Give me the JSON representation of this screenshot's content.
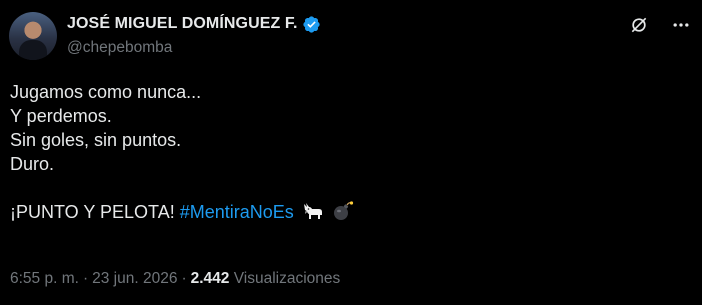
{
  "author": {
    "display_name": "JOSÉ MIGUEL DOMÍNGUEZ F.",
    "handle": "@chepebomba",
    "verified_icon": "verified-badge-icon",
    "avatar": "avatar"
  },
  "actions": {
    "grok_icon": "grok-icon",
    "more_icon": "more-icon"
  },
  "post": {
    "lines": [
      "Jugamos como nunca...",
      "Y perdemos.",
      "Sin goles, sin puntos.",
      "Duro."
    ],
    "last_line_text": "¡PUNTO Y PELOTA!",
    "hashtag": "#MentiraNoEs",
    "emojis": [
      "goat-icon",
      "bomb-icon"
    ]
  },
  "meta": {
    "time": "6:55 p. m.",
    "separator": "·",
    "date": "23 jun. 2026",
    "views_count": "2.442",
    "views_label": "Visualizaciones"
  },
  "colors": {
    "background": "#000000",
    "text": "#e7e9ea",
    "muted": "#71767b",
    "accent": "#1d9bf0"
  }
}
